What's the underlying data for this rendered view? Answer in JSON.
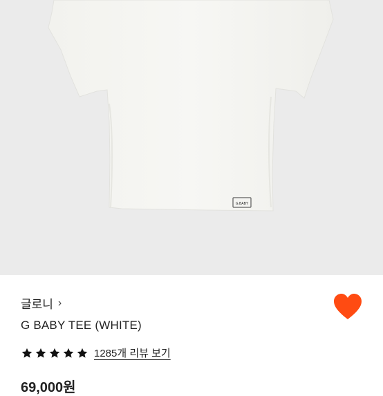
{
  "product": {
    "image_alt_icon": "tshirt-image",
    "tag_text": "G.BABY",
    "brand": "글로니",
    "brand_chevron": "›",
    "name": "G BABY TEE (WHITE)",
    "rating_stars": 5,
    "review_link": "1285개 리뷰 보기",
    "price_partial": "69,000원"
  },
  "colors": {
    "background_photo": "#ebebeb",
    "heart": "#ff4b12",
    "text": "#222222"
  },
  "icons": {
    "wishlist": "heart-icon",
    "rating": "star-icon",
    "brand_arrow": "chevron-right-icon"
  }
}
